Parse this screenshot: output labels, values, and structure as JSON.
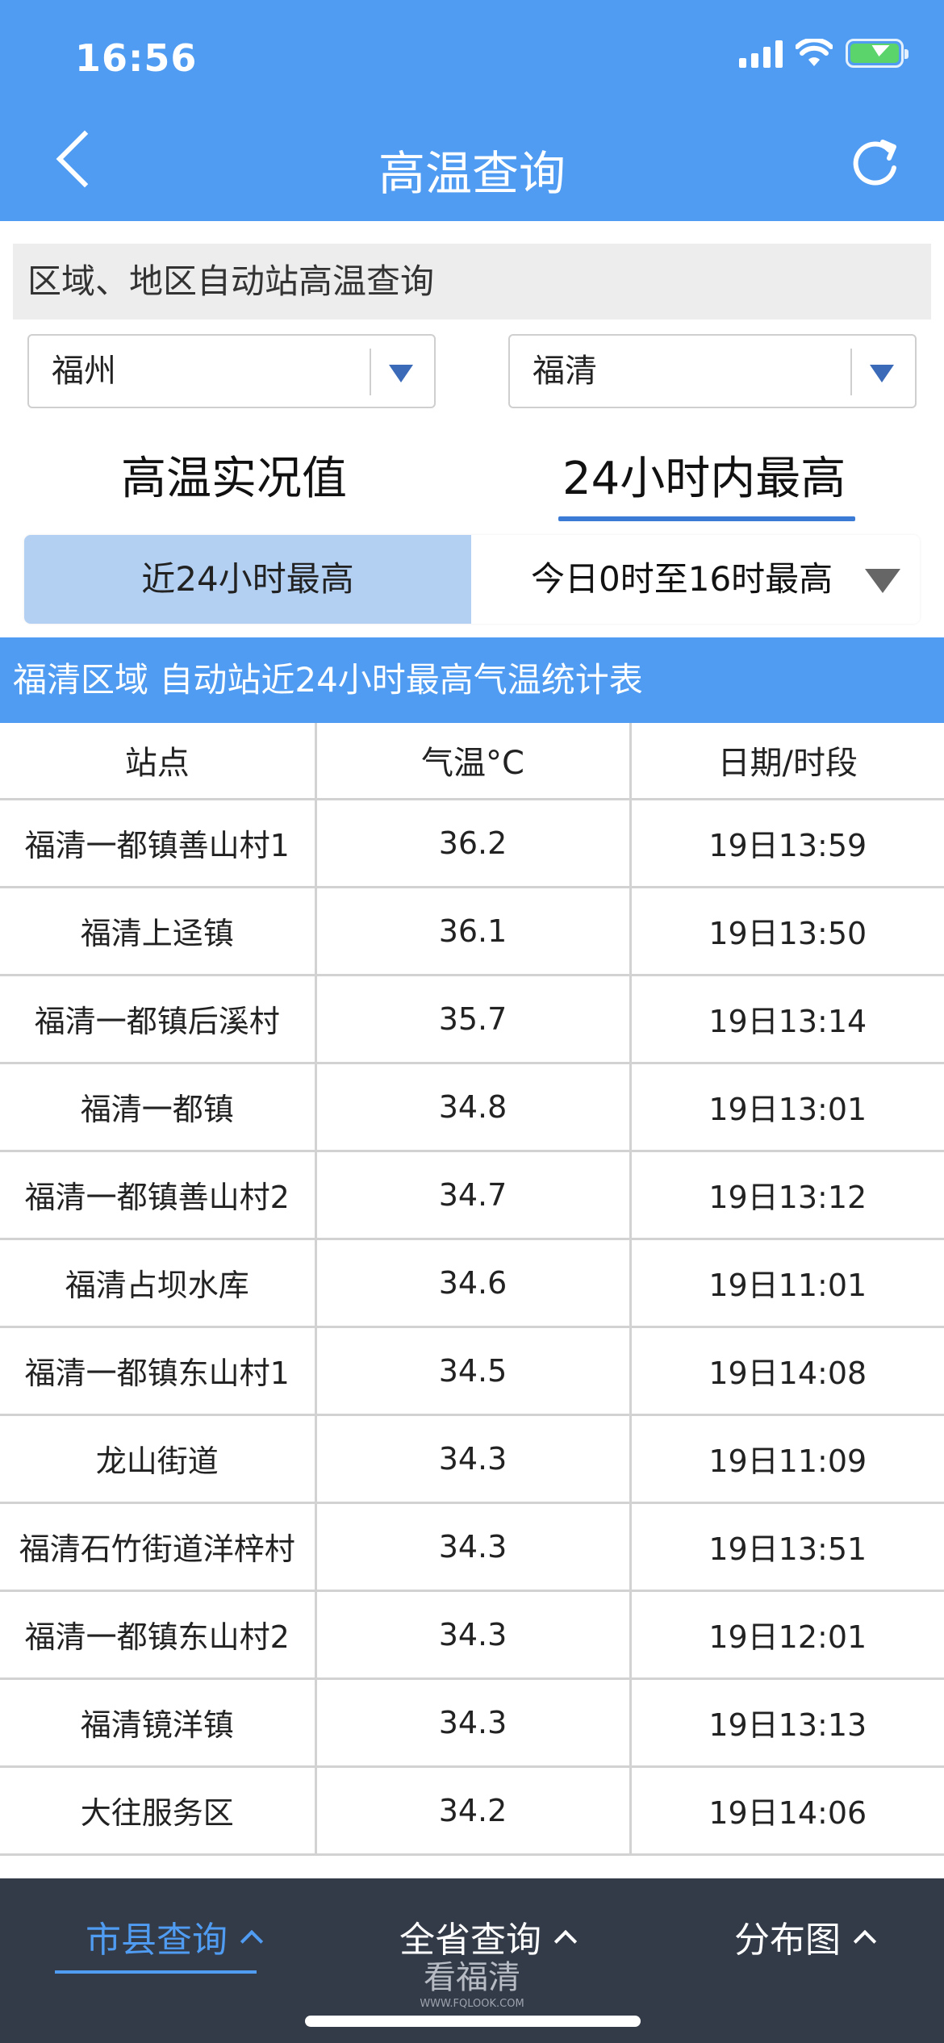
{
  "status_bar": {
    "time": "16:56"
  },
  "header": {
    "title": "高温查询"
  },
  "query": {
    "section_label": "区域、地区自动站高温查询",
    "city": "福州",
    "county": "福清"
  },
  "tabs": {
    "left": "高温实况值",
    "right": "24小时内最高"
  },
  "segment": {
    "left": "近24小时最高",
    "right": "今日0时至16时最高"
  },
  "table": {
    "title": "福清区域 自动站近24小时最高气温统计表",
    "headers": [
      "站点",
      "气温°C",
      "日期/时段"
    ],
    "rows": [
      [
        "福清一都镇善山村1",
        "36.2",
        "19日13:59"
      ],
      [
        "福清上迳镇",
        "36.1",
        "19日13:50"
      ],
      [
        "福清一都镇后溪村",
        "35.7",
        "19日13:14"
      ],
      [
        "福清一都镇",
        "34.8",
        "19日13:01"
      ],
      [
        "福清一都镇善山村2",
        "34.7",
        "19日13:12"
      ],
      [
        "福清占坝水库",
        "34.6",
        "19日11:01"
      ],
      [
        "福清一都镇东山村1",
        "34.5",
        "19日14:08"
      ],
      [
        "龙山街道",
        "34.3",
        "19日11:09"
      ],
      [
        "福清石竹街道洋梓村",
        "34.3",
        "19日13:51"
      ],
      [
        "福清一都镇东山村2",
        "34.3",
        "19日12:01"
      ],
      [
        "福清镜洋镇",
        "34.3",
        "19日13:13"
      ],
      [
        "大往服务区",
        "34.2",
        "19日14:06"
      ]
    ]
  },
  "bottom_nav": {
    "items": [
      "市县查询",
      "全省查询",
      "分布图"
    ],
    "watermark": "看福清",
    "watermark_url": "WWW.FQLOOK.COM"
  },
  "colors": {
    "primary": "#4f9cf2",
    "segment_active": "#b3d0f3",
    "nav_bg": "#343b48"
  },
  "icons": [
    "back-arrow-icon",
    "refresh-icon",
    "dropdown-caret-icon",
    "chevron-up-icon"
  ]
}
